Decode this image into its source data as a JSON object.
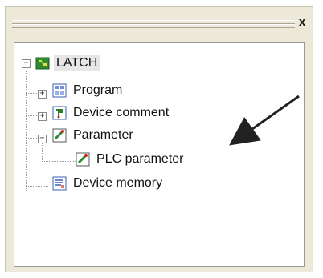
{
  "window": {
    "close_glyph": "x"
  },
  "tree": {
    "root": {
      "label": "LATCH",
      "toggle": "−",
      "icon": "project-icon"
    },
    "items": [
      {
        "label": "Program",
        "toggle": "+",
        "icon": "program-icon"
      },
      {
        "label": "Device comment",
        "toggle": "+",
        "icon": "device-comment-icon"
      },
      {
        "label": "Parameter",
        "toggle": "−",
        "icon": "parameter-icon",
        "children": [
          {
            "label": "PLC parameter",
            "icon": "plc-parameter-icon"
          }
        ]
      },
      {
        "label": "Device memory",
        "icon": "device-memory-icon"
      }
    ]
  },
  "colors": {
    "panel_bg": "#ece9d8",
    "tree_bg": "#ffffff",
    "selected_root_bg": "#e6e6e6",
    "arrow": "#222222"
  }
}
